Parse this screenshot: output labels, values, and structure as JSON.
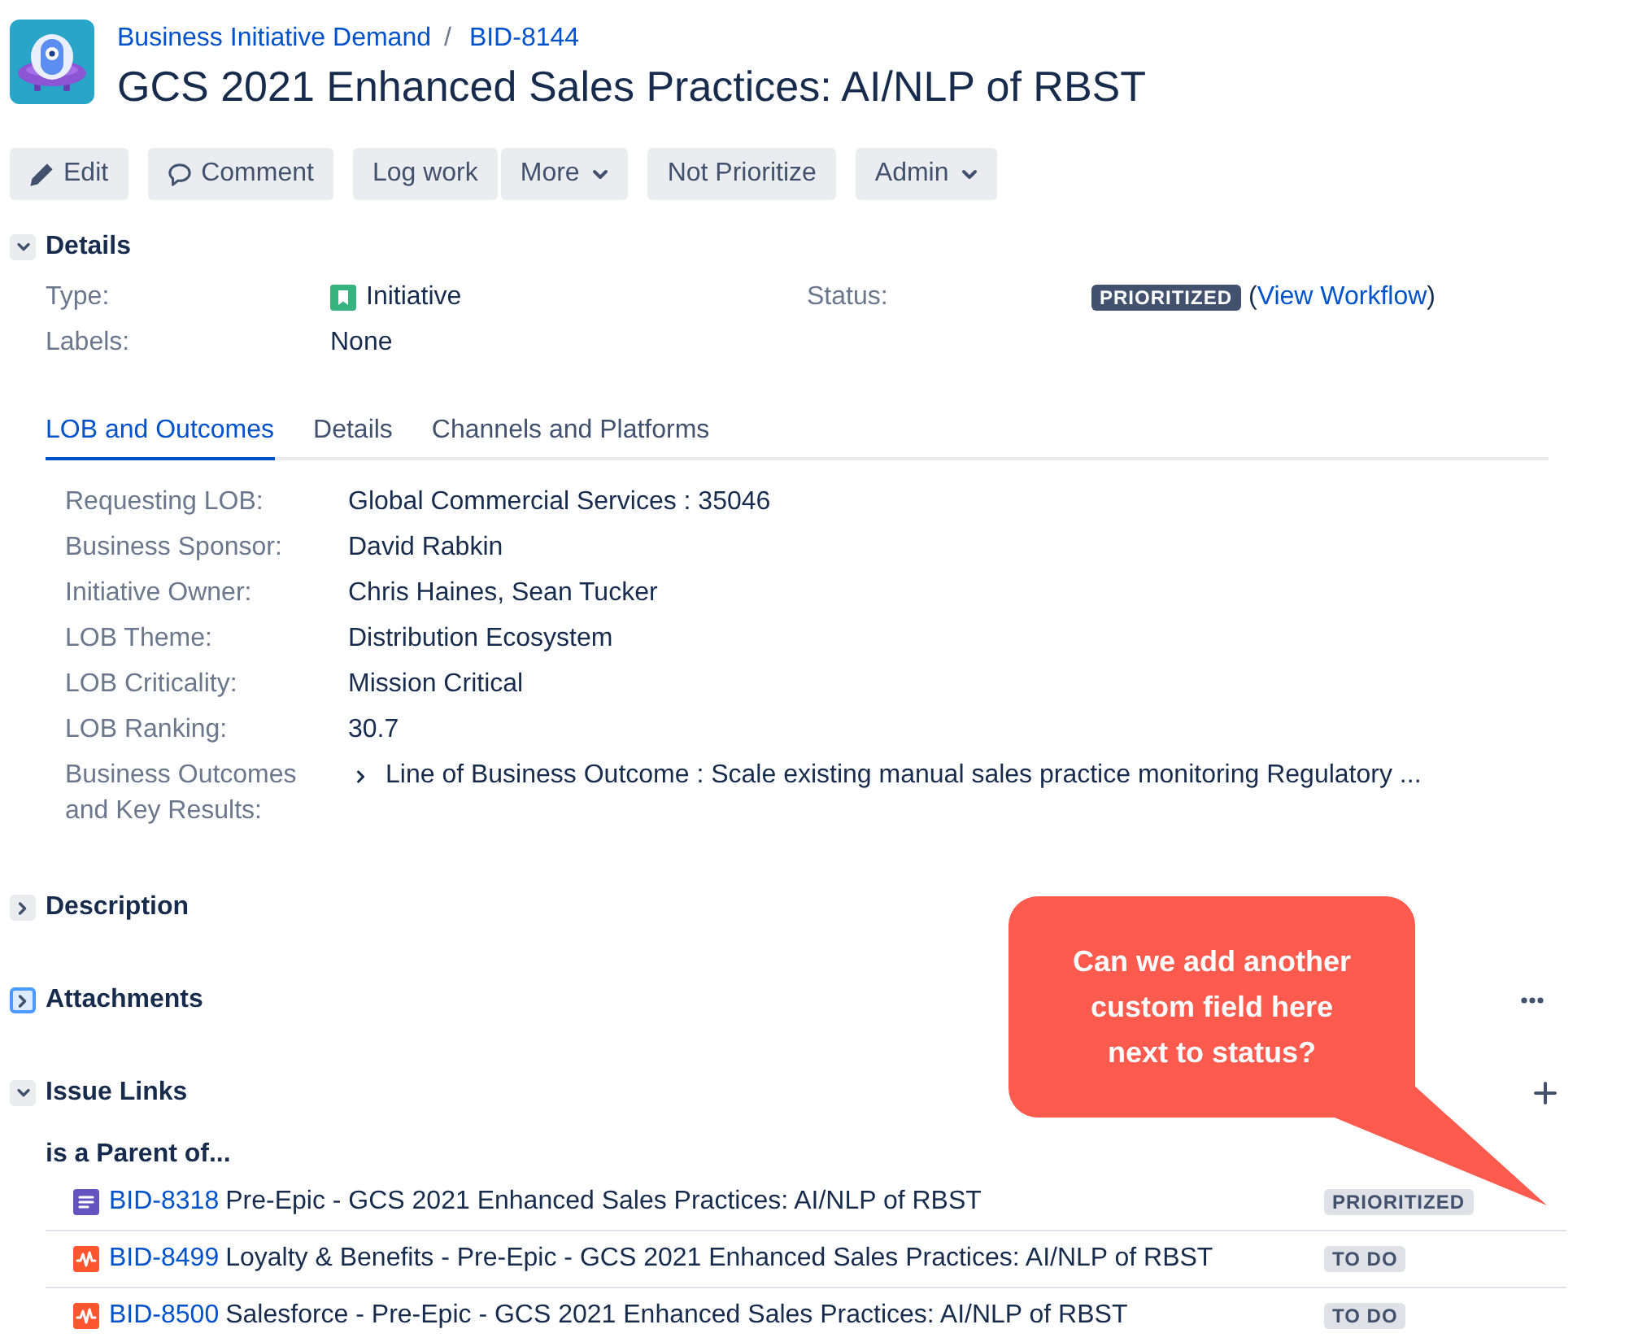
{
  "header": {
    "breadcrumbs": [
      "Business Initiative Demand",
      "BID-8144"
    ],
    "separator": "/",
    "title": "GCS 2021 Enhanced Sales Practices: AI/NLP of RBST"
  },
  "toolbar": [
    {
      "buttons": [
        {
          "label": "Edit",
          "kind": "edit"
        }
      ]
    },
    {
      "buttons": [
        {
          "label": "Comment",
          "kind": "comment"
        }
      ]
    },
    {
      "buttons": [
        {
          "label": "Log work",
          "kind": "plain"
        },
        {
          "label": "More",
          "kind": "menu"
        }
      ]
    },
    {
      "buttons": [
        {
          "label": "Not Prioritize",
          "kind": "plain"
        }
      ]
    },
    {
      "buttons": [
        {
          "label": "Admin",
          "kind": "menu"
        }
      ]
    }
  ],
  "details": {
    "title": "Details",
    "expanded": true,
    "focused": false,
    "fields": [
      {
        "label": "Type:",
        "value": "Initiative",
        "kind": "type"
      },
      {
        "label": "Labels:",
        "value": "None",
        "kind": "text"
      }
    ],
    "status": {
      "label": "Status:",
      "badge": "PRIORITIZED",
      "before": "(",
      "link": "View Workflow",
      "after": ")"
    },
    "tabs": [
      {
        "label": "LOB and Outcomes",
        "selected": true
      },
      {
        "label": "Details",
        "selected": false
      },
      {
        "label": "Channels and Platforms",
        "selected": false
      }
    ],
    "tab_fields": [
      {
        "label": "Requesting LOB:",
        "value": "Global Commercial Services : 35046",
        "expandable": false
      },
      {
        "label": "Business Sponsor:",
        "value": "David Rabkin",
        "expandable": false
      },
      {
        "label": "Initiative Owner:",
        "value": "Chris Haines, Sean Tucker",
        "expandable": false
      },
      {
        "label": "LOB Theme:",
        "value": "Distribution Ecosystem",
        "expandable": false
      },
      {
        "label": "LOB Criticality:",
        "value": "Mission Critical",
        "expandable": false
      },
      {
        "label": "LOB Ranking:",
        "value": "30.7",
        "expandable": false
      },
      {
        "label": "Business Outcomes and Key Results:",
        "value": "Line of Business Outcome : Scale existing manual sales practice monitoring Regulatory ...",
        "expandable": true
      }
    ]
  },
  "sections": [
    {
      "title": "Description",
      "kind": "plain",
      "expanded": false,
      "focused": false
    },
    {
      "title": "Attachments",
      "kind": "menu",
      "expanded": false,
      "focused": true
    },
    {
      "title": "Issue Links",
      "kind": "adder",
      "expanded": true,
      "focused": false,
      "groups": [
        {
          "title": "is a Parent of...",
          "items": [
            {
              "kind": "document",
              "key": "BID-8318",
              "summary": "Pre-Epic - GCS 2021 Enhanced Sales Practices: AI/NLP of RBST",
              "status": "PRIORITIZED"
            },
            {
              "kind": "pulse",
              "key": "BID-8499",
              "summary": "Loyalty & Benefits - Pre-Epic - GCS 2021 Enhanced Sales Practices: AI/NLP of RBST",
              "status": "TO DO"
            },
            {
              "kind": "pulse",
              "key": "BID-8500",
              "summary": "Salesforce - Pre-Epic - GCS 2021 Enhanced Sales Practices: AI/NLP of RBST",
              "status": "TO DO"
            }
          ]
        }
      ]
    }
  ],
  "callout": {
    "text": "Can we add another custom field here next to status?"
  }
}
